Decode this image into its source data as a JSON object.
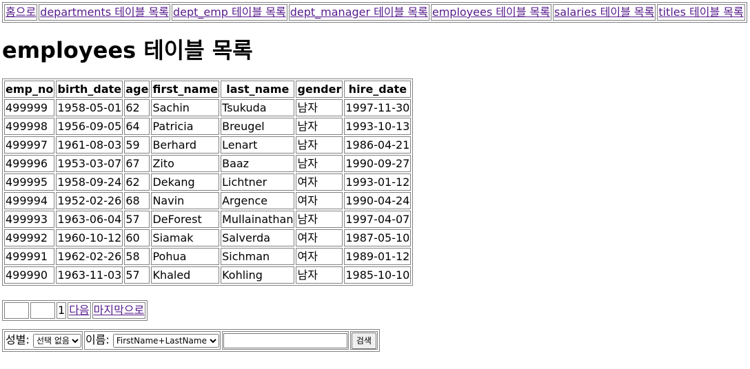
{
  "nav": {
    "links": [
      {
        "label": "홈으로"
      },
      {
        "label": "departments 테이블 목록"
      },
      {
        "label": "dept_emp 테이블 목록"
      },
      {
        "label": "dept_manager 테이블 목록"
      },
      {
        "label": "employees 테이블 목록"
      },
      {
        "label": "salaries 테이블 목록"
      },
      {
        "label": "titles 테이블 목록"
      }
    ]
  },
  "page_title": "employees 테이블 목록",
  "table": {
    "headers": [
      "emp_no",
      "birth_date",
      "age",
      "first_name",
      "last_name",
      "gender",
      "hire_date"
    ],
    "rows": [
      [
        "499999",
        "1958-05-01",
        "62",
        "Sachin",
        "Tsukuda",
        "남자",
        "1997-11-30"
      ],
      [
        "499998",
        "1956-09-05",
        "64",
        "Patricia",
        "Breugel",
        "남자",
        "1993-10-13"
      ],
      [
        "499997",
        "1961-08-03",
        "59",
        "Berhard",
        "Lenart",
        "남자",
        "1986-04-21"
      ],
      [
        "499996",
        "1953-03-07",
        "67",
        "Zito",
        "Baaz",
        "남자",
        "1990-09-27"
      ],
      [
        "499995",
        "1958-09-24",
        "62",
        "Dekang",
        "Lichtner",
        "여자",
        "1993-01-12"
      ],
      [
        "499994",
        "1952-02-26",
        "68",
        "Navin",
        "Argence",
        "여자",
        "1990-04-24"
      ],
      [
        "499993",
        "1963-06-04",
        "57",
        "DeForest",
        "Mullainathan",
        "남자",
        "1997-04-07"
      ],
      [
        "499992",
        "1960-10-12",
        "60",
        "Siamak",
        "Salverda",
        "여자",
        "1987-05-10"
      ],
      [
        "499991",
        "1962-02-26",
        "58",
        "Pohua",
        "Sichman",
        "여자",
        "1989-01-12"
      ],
      [
        "499990",
        "1963-11-03",
        "57",
        "Khaled",
        "Kohling",
        "남자",
        "1985-10-10"
      ]
    ]
  },
  "pager": {
    "current_page": "1",
    "next_label": "다음",
    "last_label": "마지막으로"
  },
  "search": {
    "gender_label": "성별:",
    "gender_selected": "선택 없음",
    "name_label": "이름:",
    "name_selected": "FirstName+LastName",
    "query_value": "",
    "submit_label": "검색"
  }
}
